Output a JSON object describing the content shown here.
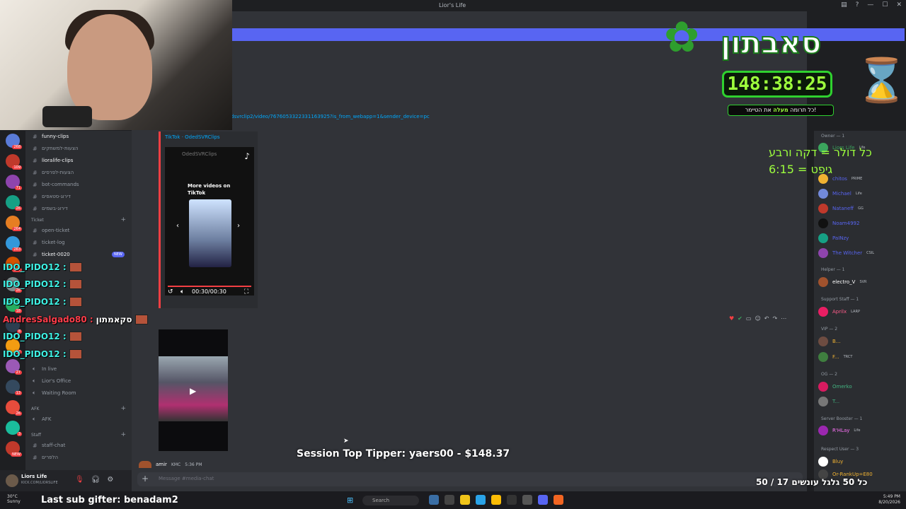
{
  "window": {
    "title": "Lior's Life"
  },
  "webcam": {},
  "sabaton": {
    "title": "סאבתון",
    "timer": "148:38:25",
    "note_prefix": "כל תרומה",
    "note_highlight": "מעלה",
    "note_suffix": "את הטיימר!"
  },
  "rate_note": {
    "line1": "כל דולר = דקה ורבע",
    "line2": "גיפט = 6:15"
  },
  "servers": [
    {
      "color": "#5a7bd8",
      "count": "268"
    },
    {
      "color": "#c0392b",
      "count": "109"
    },
    {
      "color": "#8e44ad",
      "count": "71"
    },
    {
      "color": "#16a085",
      "count": "26"
    },
    {
      "color": "#e67e22",
      "count": "264"
    },
    {
      "color": "#3498db",
      "count": "263"
    },
    {
      "color": "#d35400",
      "count": "167"
    },
    {
      "color": "#7f8c8d",
      "count": "26"
    },
    {
      "color": "#27ae60",
      "count": "18"
    },
    {
      "color": "#2c3e50",
      "count": "8"
    },
    {
      "color": "#f39c12",
      "count": "52"
    },
    {
      "color": "#9b59b6",
      "count": "27"
    },
    {
      "color": "#34495e",
      "count": "13"
    },
    {
      "color": "#e74c3c",
      "count": "26"
    },
    {
      "color": "#1abc9c",
      "count": "3"
    },
    {
      "color": "#c0392b",
      "count": "NEW"
    }
  ],
  "channels": {
    "items": [
      {
        "name": "funny-clips",
        "active": true
      },
      {
        "name": "הצעות-למשחקים"
      },
      {
        "name": "lioralife-clips",
        "active": true
      },
      {
        "name": "הצעות-לפרסים"
      },
      {
        "name": "bot-commands"
      },
      {
        "name": "דירוג-סטאפים"
      },
      {
        "name": "דירוג-בשמים"
      }
    ],
    "ticket_category": "Ticket",
    "ticket_items": [
      {
        "name": "open-ticket"
      },
      {
        "name": "ticket-log"
      },
      {
        "name": "ticket-0020",
        "active": true
      }
    ],
    "new_badge": "NEW",
    "office_items": [
      {
        "name": "In live"
      },
      {
        "name": "Lior's Office"
      },
      {
        "name": "Waiting Room"
      }
    ],
    "afk_category": "AFK",
    "afk_item": "AFK",
    "staff_category": "Staff",
    "staff_items": [
      {
        "name": "staff-chat"
      },
      {
        "name": "הלפרים"
      }
    ]
  },
  "user_panel": {
    "name": "Liors Life",
    "status": "KICK.COM/LIORSLIFE"
  },
  "main": {
    "link": "dsvrclip2/video/7676053322331163925?is_from_webapp=1&sender_device=pc",
    "tiktok": {
      "provider": "TikTok · OdedSVRClips",
      "owner": "OdedSVRClips",
      "more": "More videos on TikTok",
      "time": "00:30/00:30"
    },
    "msg2": {
      "author": "amir",
      "tag": "KMC",
      "time": "5:36 PM"
    },
    "composer_placeholder": "Message #media-chat"
  },
  "members": {
    "groups": [
      {
        "label": "Owner — 1"
      },
      {
        "label": "Helper — 1"
      },
      {
        "label": "Support Staff — 1"
      },
      {
        "label": "VIP — 2"
      },
      {
        "label": "OG — 2"
      },
      {
        "label": "Server Booster — 1"
      },
      {
        "label": "Respect User — 3"
      }
    ],
    "list": [
      {
        "name": "Liors Life",
        "color": "#3ba55d",
        "tag": "Life"
      },
      {
        "name": "chitos",
        "color": "#5865f2",
        "tag": "PRIME"
      },
      {
        "name": "Michael",
        "color": "#5865f2",
        "tag": "Life"
      },
      {
        "name": "Nataneff",
        "color": "#5865f2",
        "tag": "GG"
      },
      {
        "name": "Noam4992",
        "color": "#5865f2",
        "tag": ""
      },
      {
        "name": "PaINzy",
        "color": "#5865f2",
        "tag": ""
      },
      {
        "name": "The Witcher",
        "color": "#5865f2",
        "tag": "CSIL"
      },
      {
        "name": "electro_V",
        "color": "#ffffff",
        "tag": "SVR"
      },
      {
        "name": "Aprilx",
        "color": "#ff5c8a",
        "tag": "LARP"
      },
      {
        "name": "B...",
        "color": "#f0b232",
        "tag": ""
      },
      {
        "name": "F...",
        "color": "#f0b232",
        "tag": "TRCT"
      },
      {
        "name": "Omerko",
        "color": "#43b581",
        "tag": ""
      },
      {
        "name": "T...",
        "color": "#43b581",
        "tag": ""
      },
      {
        "name": "R'HLay",
        "color": "#ff73fa",
        "tag": "Life"
      },
      {
        "name": "Bluy",
        "color": "#f0b232",
        "tag": ""
      },
      {
        "name": "Or-RankUp=E80",
        "color": "#f0b232",
        "tag": ""
      }
    ]
  },
  "chat_overlay": [
    {
      "user": "IDO_PIDO12 :",
      "color": "cyan"
    },
    {
      "user": "IDO_PIDO12 :",
      "color": "cyan"
    },
    {
      "user": "IDO_PIDO12 :",
      "color": "cyan"
    },
    {
      "user": "AndresSalgado80 :",
      "text": "סקאמתון",
      "color": "red"
    },
    {
      "user": "IDO_PIDO12 :",
      "color": "cyan"
    },
    {
      "user": "IDO_PIDO12 :",
      "color": "cyan"
    }
  ],
  "stream_overlays": {
    "top_tipper": "Session Top Tipper: yaers00 - $148.37",
    "subs_goal": "כל 50 גלגל עונשים 17 / 50",
    "last_sub": "Last sub gifter: benadam2"
  },
  "taskbar": {
    "weather_temp": "30°C",
    "weather_desc": "Sunny",
    "search": "Search",
    "time": "5:49 PM",
    "date": "8/20/2026"
  }
}
